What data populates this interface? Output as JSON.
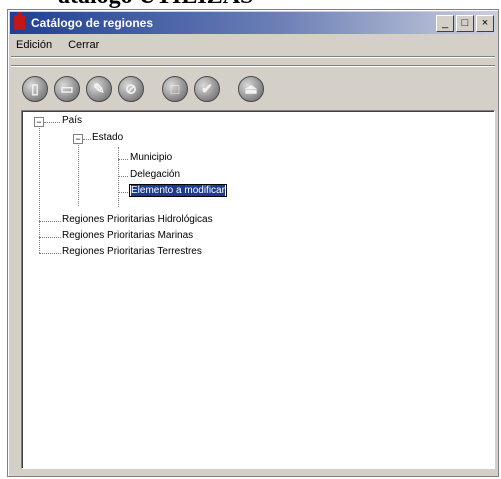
{
  "top_fragment": "atalogo UTILIZAS",
  "window": {
    "title": "Catálogo de regiones",
    "buttons": {
      "minimize": "_",
      "maximize": "□",
      "close": "×"
    }
  },
  "menu": {
    "items": [
      "Edición",
      "Cerrar"
    ]
  },
  "toolbar": {
    "icons": [
      "add-node-icon",
      "save-icon",
      "edit-icon",
      "delete-icon",
      "cancel-icon",
      "accept-icon",
      "exit-icon"
    ]
  },
  "tree": {
    "pais": "País",
    "estado": "Estado",
    "municipio": "Municipio",
    "delegacion": "Delegación",
    "editing_value": "Elemento a modificar",
    "reg_hidro": "Regiones Prioritarias Hidrológicas",
    "reg_marinas": "Regiones Prioritarias Marinas",
    "reg_terrestres": "Regiones Prioritarias Terrestres",
    "expander_symbol": "−"
  }
}
